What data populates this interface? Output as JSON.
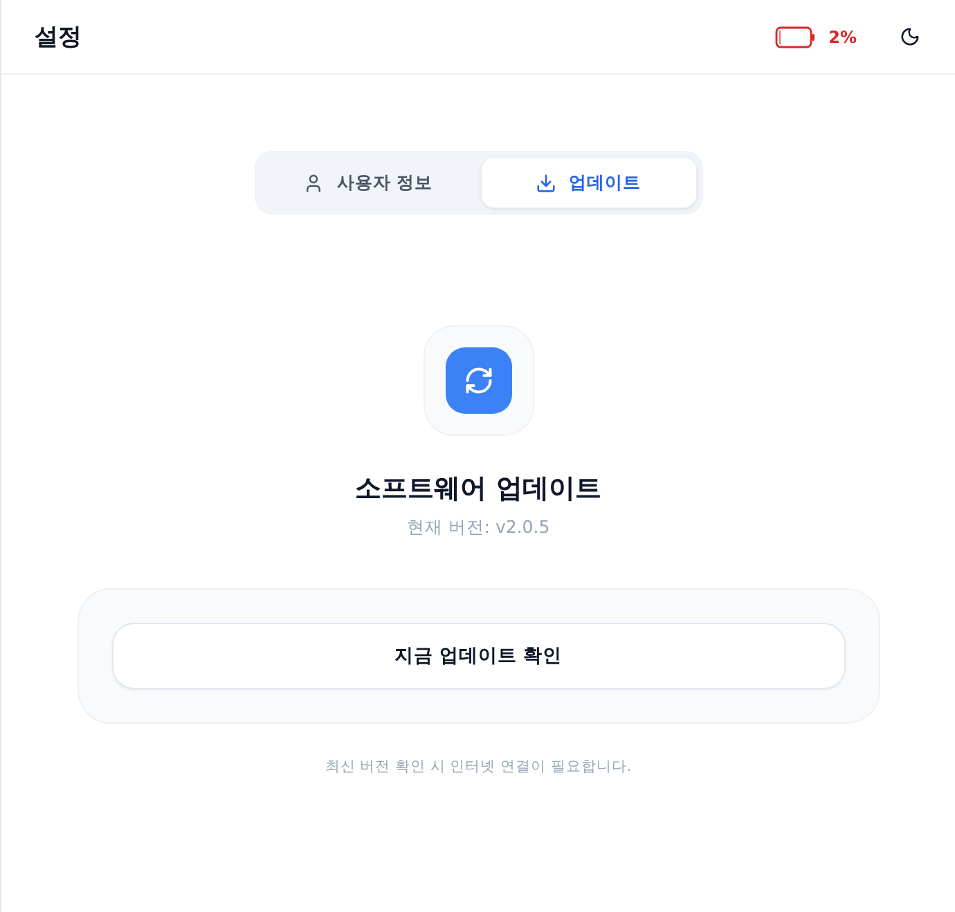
{
  "header": {
    "title": "설정",
    "battery": {
      "reading": "2%"
    }
  },
  "tabs": [
    {
      "label": "사용자 정보",
      "kind": "profile",
      "selected": false
    },
    {
      "label": "업데이트",
      "kind": "update",
      "selected": true
    }
  ],
  "update": {
    "title": "소프트웨어 업데이트",
    "version": "현재 버전: v2.0.5",
    "button": "지금 업데이트 확인",
    "note": "최신 버전 확인 시 인터넷 연결이 필요합니다."
  }
}
